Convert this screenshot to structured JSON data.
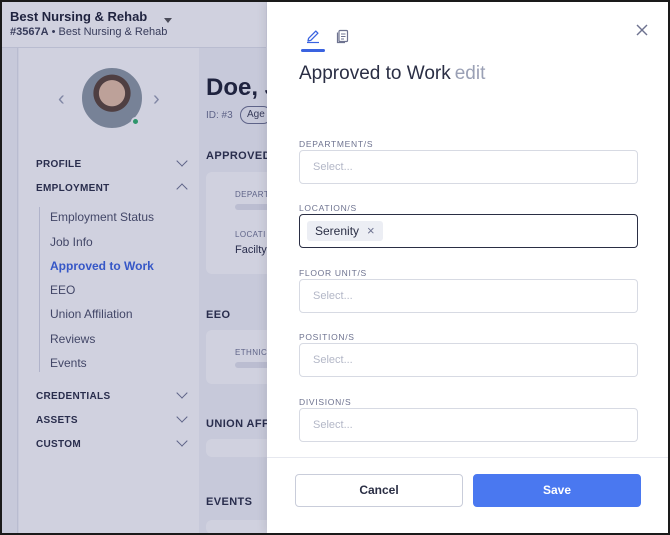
{
  "org": {
    "name": "Best Nursing & Rehab",
    "code": "#3567A",
    "subtitle": "• Best Nursing & Rehab"
  },
  "profile": {
    "name": "Doe, J",
    "id_label": "ID: #3",
    "agency_pill": "Age"
  },
  "sidebar": {
    "sections": [
      {
        "label": "PROFILE",
        "expanded": false
      },
      {
        "label": "EMPLOYMENT",
        "expanded": true
      },
      {
        "label": "CREDENTIALS",
        "expanded": false
      },
      {
        "label": "ASSETS",
        "expanded": false
      },
      {
        "label": "CUSTOM",
        "expanded": false
      }
    ],
    "employment_items": [
      {
        "label": "Employment Status",
        "active": false
      },
      {
        "label": "Job Info",
        "active": false
      },
      {
        "label": "Approved to Work",
        "active": true
      },
      {
        "label": "EEO",
        "active": false
      },
      {
        "label": "Union Affiliation",
        "active": false
      },
      {
        "label": "Reviews",
        "active": false
      },
      {
        "label": "Events",
        "active": false
      }
    ]
  },
  "main": {
    "sections": [
      {
        "title": "APPROVED"
      },
      {
        "title": "EEO"
      },
      {
        "title": "UNION AFF"
      },
      {
        "title": "EVENTS"
      }
    ],
    "approved_card": {
      "label1": "DEPART",
      "label2": "LOCATI",
      "value2": "Facilty"
    },
    "eeo_card": {
      "label1": "ETHNIC"
    }
  },
  "drawer": {
    "title": "Approved to Work",
    "title_suffix": "edit",
    "tabs": [
      {
        "icon": "pencil-icon",
        "active": true
      },
      {
        "icon": "document-icon",
        "active": false
      }
    ],
    "fields": [
      {
        "label": "DEPARTMENT/S",
        "placeholder": "Select..."
      },
      {
        "label": "LOCATION/S",
        "chip": "Serenity"
      },
      {
        "label": "FLOOR UNIT/S",
        "placeholder": "Select..."
      },
      {
        "label": "POSITION/S",
        "placeholder": "Select..."
      },
      {
        "label": "DIVISION/S",
        "placeholder": "Select..."
      }
    ],
    "cancel_label": "Cancel",
    "save_label": "Save"
  },
  "colors": {
    "accent": "#3a63e0",
    "save_button": "#4a78f0",
    "overlay": "#282c6e",
    "online_dot": "#2fb36b"
  }
}
